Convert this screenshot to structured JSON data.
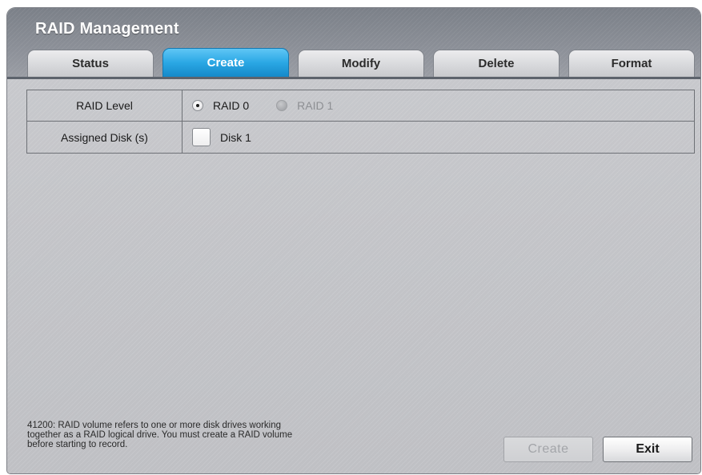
{
  "window": {
    "title": "RAID Management"
  },
  "tabs": [
    {
      "label": "Status",
      "active": false
    },
    {
      "label": "Create",
      "active": true
    },
    {
      "label": "Modify",
      "active": false
    },
    {
      "label": "Delete",
      "active": false
    },
    {
      "label": "Format",
      "active": false
    }
  ],
  "form": {
    "raid_level": {
      "label": "RAID Level",
      "options": [
        {
          "label": "RAID 0",
          "checked": true,
          "enabled": true
        },
        {
          "label": "RAID 1",
          "checked": false,
          "enabled": false
        }
      ]
    },
    "assigned_disks": {
      "label": "Assigned Disk (s)",
      "disks": [
        {
          "label": "Disk 1",
          "checked": false
        }
      ]
    }
  },
  "footnote": {
    "line1": "41200: RAID volume refers to one or more disk drives working",
    "line2": "together as a RAID logical drive. You must create a RAID volume",
    "line3": "before starting to record."
  },
  "buttons": {
    "create_label": "Create",
    "create_enabled": false,
    "exit_label": "Exit"
  },
  "colors": {
    "active_tab": "#2aa7e4",
    "titlebar": "#8c9098",
    "background": "#c5c6ca"
  }
}
